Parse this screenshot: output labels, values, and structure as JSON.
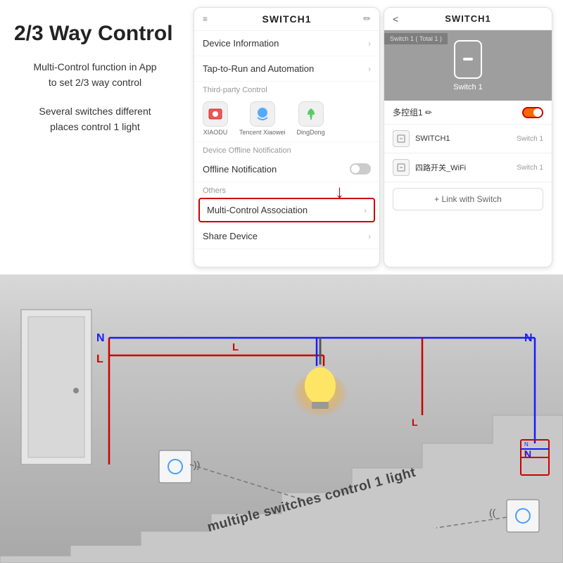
{
  "left_panel": {
    "title": "2/3 Way Control",
    "desc1": "Multi-Control function in App\nto set 2/3 way control",
    "desc2": "Several switches different\nplaces control 1 light"
  },
  "phone_left": {
    "header": "SWITCH1",
    "edit_icon": "✏",
    "menu_items": [
      {
        "label": "Device Information",
        "type": "link"
      },
      {
        "label": "Tap-to-Run and Automation",
        "type": "link"
      },
      {
        "section": "Third-party Control"
      },
      {
        "label": "third-party-icons"
      },
      {
        "section": "Device Offline Notification"
      },
      {
        "label": "Offline Notification",
        "type": "toggle"
      },
      {
        "section": "Others"
      },
      {
        "label": "Multi-Control Association",
        "type": "link-highlighted"
      },
      {
        "label": "Share Device",
        "type": "link"
      }
    ],
    "third_party": [
      {
        "label": "XIAODU",
        "emoji": "🎵"
      },
      {
        "label": "Tencent Xiaowei",
        "emoji": "☁"
      },
      {
        "label": "DingDong",
        "emoji": "🔔"
      }
    ]
  },
  "phone_right": {
    "header": "SWITCH1",
    "back": "<",
    "breadcrumb": "Switch 1 ( Total 1 )",
    "switch_label": "Switch 1",
    "multicontrol": "多控组1 ✏",
    "devices": [
      {
        "name": "SWITCH1",
        "type": "Switch 1"
      },
      {
        "name": "四路开关_WiFi",
        "type": "Switch 1"
      }
    ],
    "link_button": "+ Link with Switch"
  },
  "bottom_diagram": {
    "title_text": "multiple switches control 1 light",
    "n_labels": [
      "N",
      "N",
      "N"
    ],
    "l_labels": [
      "L",
      "L"
    ],
    "wire_colors": {
      "neutral": "#1a1aff",
      "live": "#cc0000"
    }
  }
}
